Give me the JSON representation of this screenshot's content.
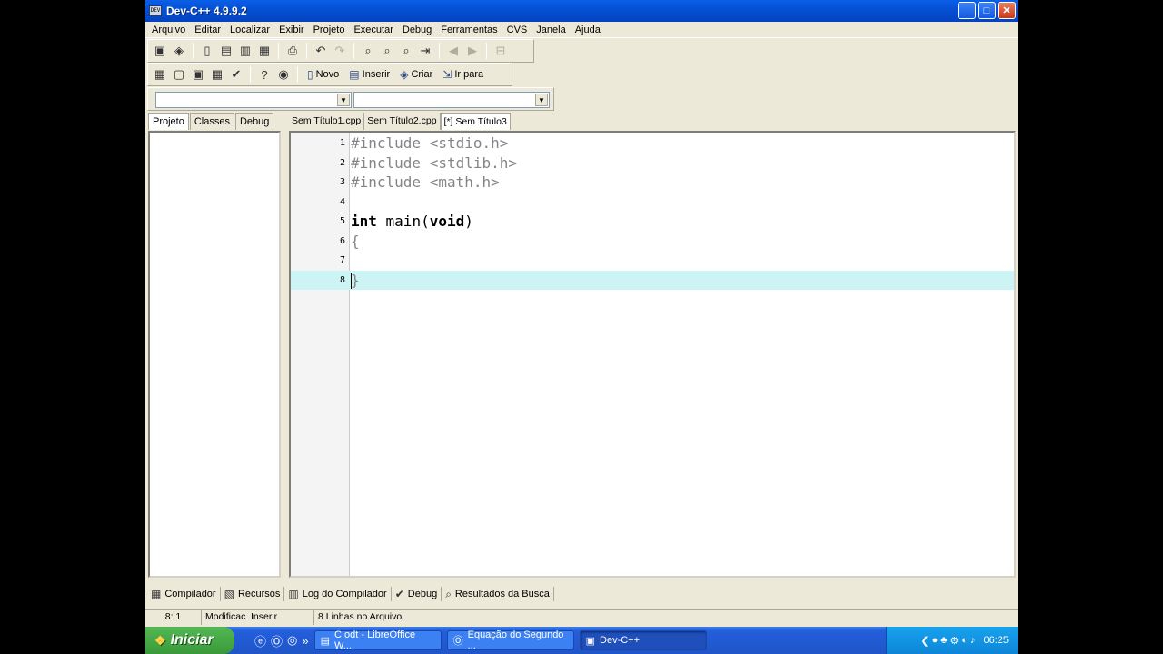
{
  "window": {
    "title": "Dev-C++ 4.9.9.2",
    "icon": "devcpp-app-icon",
    "min_glyph": "_",
    "max_glyph": "□",
    "close_glyph": "✕"
  },
  "menu": [
    "Arquivo",
    "Editar",
    "Localizar",
    "Exibir",
    "Projeto",
    "Executar",
    "Debug",
    "Ferramentas",
    "CVS",
    "Janela",
    "Ajuda"
  ],
  "toolbar2_text_buttons": [
    {
      "label": "Novo",
      "icon": "new-class-icon"
    },
    {
      "label": "Inserir",
      "icon": "insert-icon"
    },
    {
      "label": "Criar",
      "icon": "toggle-bookmark-icon"
    },
    {
      "label": "Ir para",
      "icon": "goto-icon"
    }
  ],
  "left_tabs": [
    "Projeto",
    "Classes",
    "Debug"
  ],
  "editor_tabs": [
    "Sem Título1.cpp",
    "Sem Título2.cpp",
    "[*] Sem Título3"
  ],
  "code_lines": [
    {
      "n": "1",
      "text": "#include <stdio.h>"
    },
    {
      "n": "2",
      "text": "#include <stdlib.h>"
    },
    {
      "n": "3",
      "text": "#include <math.h>"
    },
    {
      "n": "4",
      "text": ""
    },
    {
      "n": "5",
      "kw1": "int",
      "mid": " main(",
      "kw2": "void",
      "end": ")"
    },
    {
      "n": "6",
      "text": "{"
    },
    {
      "n": "7",
      "text": ""
    },
    {
      "n": "8",
      "text": "}"
    }
  ],
  "bottom_tabs": [
    "Compilador",
    "Recursos",
    "Log do Compilador",
    "Debug",
    "Resultados da Busca"
  ],
  "status": {
    "position": "8: 1",
    "mode1": "Modificac",
    "mode2": "Inserir",
    "info": "8 Linhas no Arquivo"
  },
  "taskbar": {
    "start_label": "Iniciar",
    "tasks": [
      {
        "label": "C.odt - LibreOffice W...",
        "icon": "libreoffice-icon"
      },
      {
        "label": "Equação do Segundo ...",
        "icon": "opera-icon"
      },
      {
        "label": "Dev-C++",
        "icon": "devcpp-icon",
        "active": true
      }
    ],
    "clock": "06:25"
  },
  "colors": {
    "active_line": "#ccf4f4",
    "preprocessor": "#858585",
    "titlebar": "#0551d6"
  }
}
